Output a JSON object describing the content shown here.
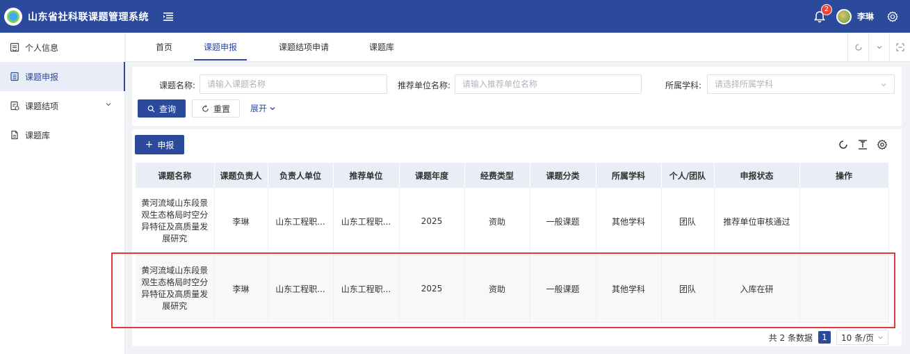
{
  "header": {
    "title": "山东省社科联课题管理系统",
    "notification_count": "2",
    "user_name": "李琳"
  },
  "sidebar": {
    "items": [
      {
        "label": "个人信息",
        "icon": "user-card-icon"
      },
      {
        "label": "课题申报",
        "icon": "document-icon",
        "active": true
      },
      {
        "label": "课题结项",
        "icon": "document-check-icon",
        "expandable": true
      },
      {
        "label": "课题库",
        "icon": "file-icon"
      }
    ]
  },
  "tabs": [
    {
      "label": "首页"
    },
    {
      "label": "课题申报",
      "active": true
    },
    {
      "label": "课题结项申请"
    },
    {
      "label": "课题库"
    }
  ],
  "search": {
    "topic_label": "课题名称:",
    "topic_placeholder": "请输入课题名称",
    "unit_label": "推荐单位名称:",
    "unit_placeholder": "请输入推荐单位名称",
    "subject_label": "所属学科:",
    "subject_placeholder": "请选择所属学科",
    "query_label": "查询",
    "reset_label": "重置",
    "expand_label": "展开"
  },
  "toolbar": {
    "add_label": "申报"
  },
  "table": {
    "columns": [
      "课题名称",
      "课题负责人",
      "负责人单位",
      "推荐单位",
      "课题年度",
      "经费类型",
      "课题分类",
      "所属学科",
      "个人/团队",
      "申报状态",
      "操作"
    ],
    "rows": [
      [
        "黄河流域山东段景观生态格局时空分异特征及高质量发展研究",
        "李琳",
        "山东工程职...",
        "山东工程职...",
        "2025",
        "资助",
        "一般课题",
        "其他学科",
        "团队",
        "推荐单位审核通过",
        ""
      ],
      [
        "黄河流域山东段景观生态格局时空分异特征及高质量发展研究",
        "李琳",
        "山东工程职...",
        "山东工程职...",
        "2025",
        "资助",
        "一般课题",
        "其他学科",
        "团队",
        "入库在研",
        ""
      ]
    ]
  },
  "pagination": {
    "total_text": "共 2 条数据",
    "current_page": "1",
    "page_size": "10 条/页"
  },
  "colors": {
    "primary": "#2b4a9c",
    "highlight": "#e53935",
    "badge": "#e8453c"
  }
}
